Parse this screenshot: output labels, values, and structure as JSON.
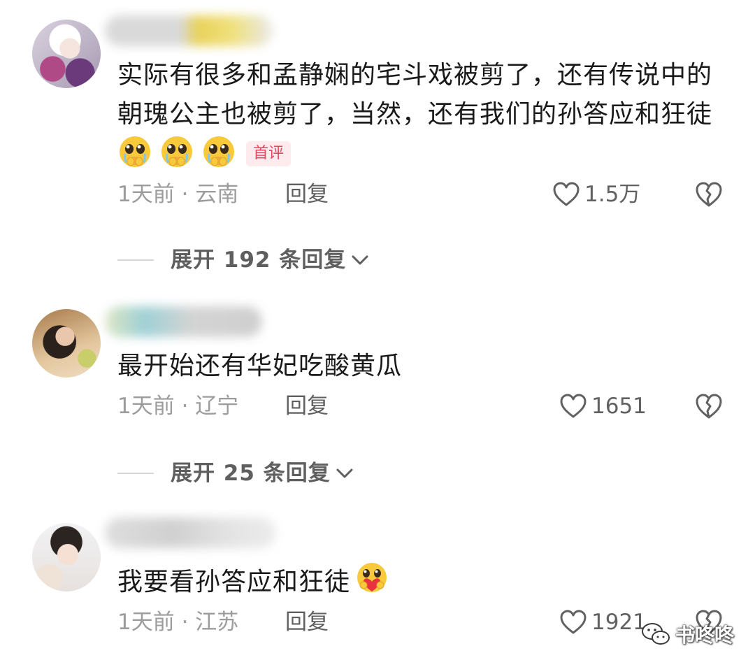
{
  "comments": [
    {
      "avatar": "anime-girl-avatar",
      "text_main": "实际有很多和孟静娴的宅斗戏被剪了，还有传说中的朝瑰公主也被剪了，当然，还有我们的孙答应和狂徒",
      "emojis": [
        "pleading-tearful-face",
        "pleading-tearful-face",
        "pleading-tearful-face"
      ],
      "badge": "首评",
      "time_location": "1天前 · 云南",
      "reply_label": "回复",
      "likes": "1.5万",
      "expand_label": "展开 192 条回复"
    },
    {
      "avatar": "woman-sunglasses-avatar",
      "text_main": "最开始还有华妃吃酸黄瓜",
      "time_location": "1天前 · 辽宁",
      "reply_label": "回复",
      "likes": "1651",
      "expand_label": "展开 25 条回复"
    },
    {
      "avatar": "woman-portrait-avatar",
      "text_main": "我要看孙答应和狂徒",
      "emojis": [
        "heart-hug-face"
      ],
      "time_location": "1天前 · 江苏",
      "reply_label": "回复",
      "likes": "1921"
    }
  ],
  "watermark": {
    "icon": "wechat-icon",
    "text": "书咚咚"
  },
  "colors": {
    "text": "#1a1a1a",
    "meta": "#9c9c9c",
    "action": "#5f5f5f",
    "badge_bg": "#fdebee",
    "badge_text": "#e8465f",
    "emoji_yellow": "#f7c93b"
  }
}
